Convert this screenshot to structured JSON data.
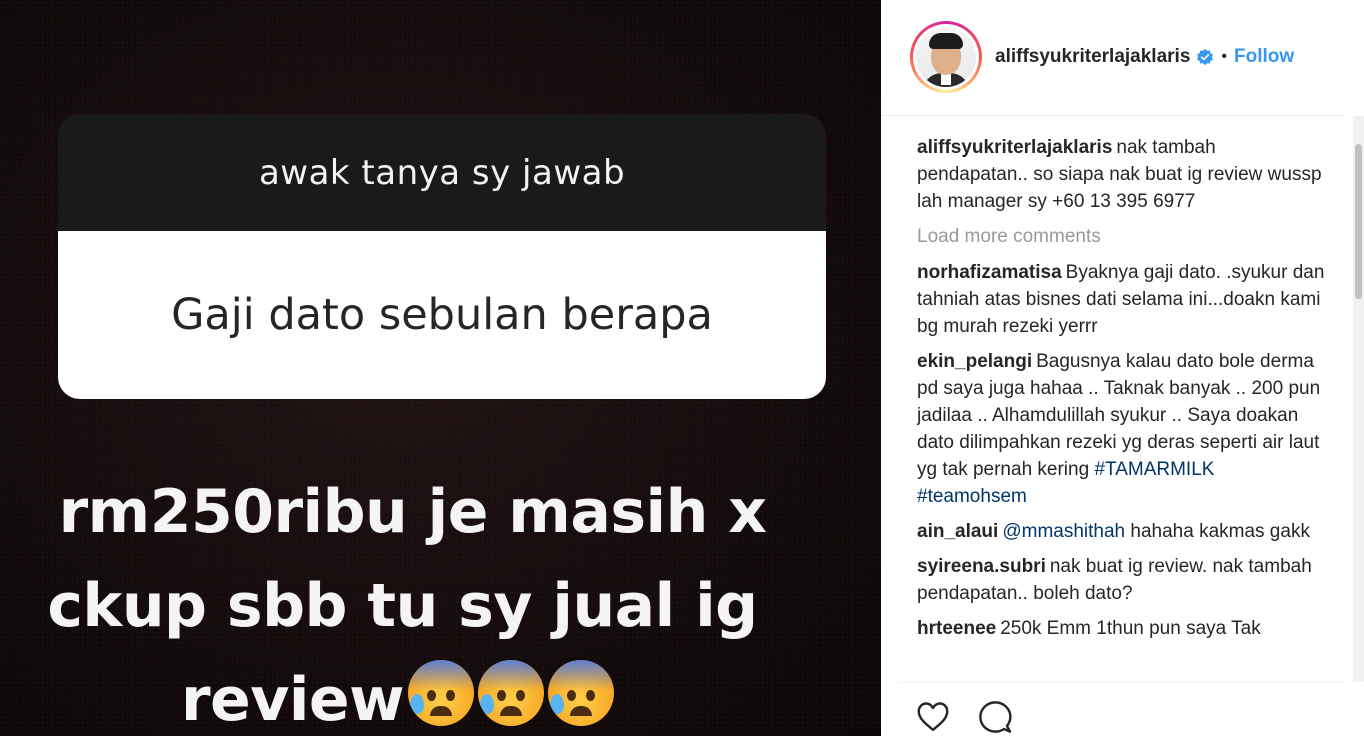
{
  "media": {
    "question_header": "awak tanya sy jawab",
    "question_text": "Gaji dato sebulan berapa",
    "answer_line1": "rm250ribu je masih x",
    "answer_line2": "ckup sbb tu sy jual ig",
    "answer_line3": "review",
    "emoji": "anxious-face-with-sweat-icon"
  },
  "header": {
    "username": "aliffsyukriterlajaklaris",
    "separator": "•",
    "follow_label": "Follow"
  },
  "caption": {
    "user": "aliffsyukriterlajaklaris",
    "text": "nak tambah pendapatan.. so siapa nak buat ig review wussp lah manager sy +60 13 395 6977"
  },
  "load_more_label": "Load more comments",
  "comments": [
    {
      "user": "norhafizamatisa",
      "text": "Byaknya gaji dato. .syukur dan tahniah atas bisnes dati selama ini...doakn kami bg murah rezeki yerrr"
    },
    {
      "user": "ekin_pelangi",
      "text": "Bagusnya kalau dato bole derma pd saya juga hahaa .. Taknak banyak .. 200 pun jadilaa .. Alhamdulillah syukur .. Saya doakan dato dilimpahkan rezeki yg deras seperti air laut yg tak pernah kering",
      "tags": [
        "#TAMARMILK",
        "#teamohsem"
      ]
    },
    {
      "user": "ain_alaui",
      "mention": "@mmashithah",
      "text": "hahaha kakmas gakk"
    },
    {
      "user": "syireena.subri",
      "text": "nak buat ig review. nak tambah pendapatan.. boleh dato?"
    },
    {
      "user": "hrteenee",
      "text": "250k Emm 1thun pun saya Tak"
    }
  ],
  "icons": {
    "verified": "verified-badge-icon",
    "like": "heart-icon",
    "comment": "comment-bubble-icon"
  },
  "colors": {
    "link": "#3897f0",
    "hashtag": "#003569",
    "muted": "#999999",
    "text": "#262626"
  }
}
